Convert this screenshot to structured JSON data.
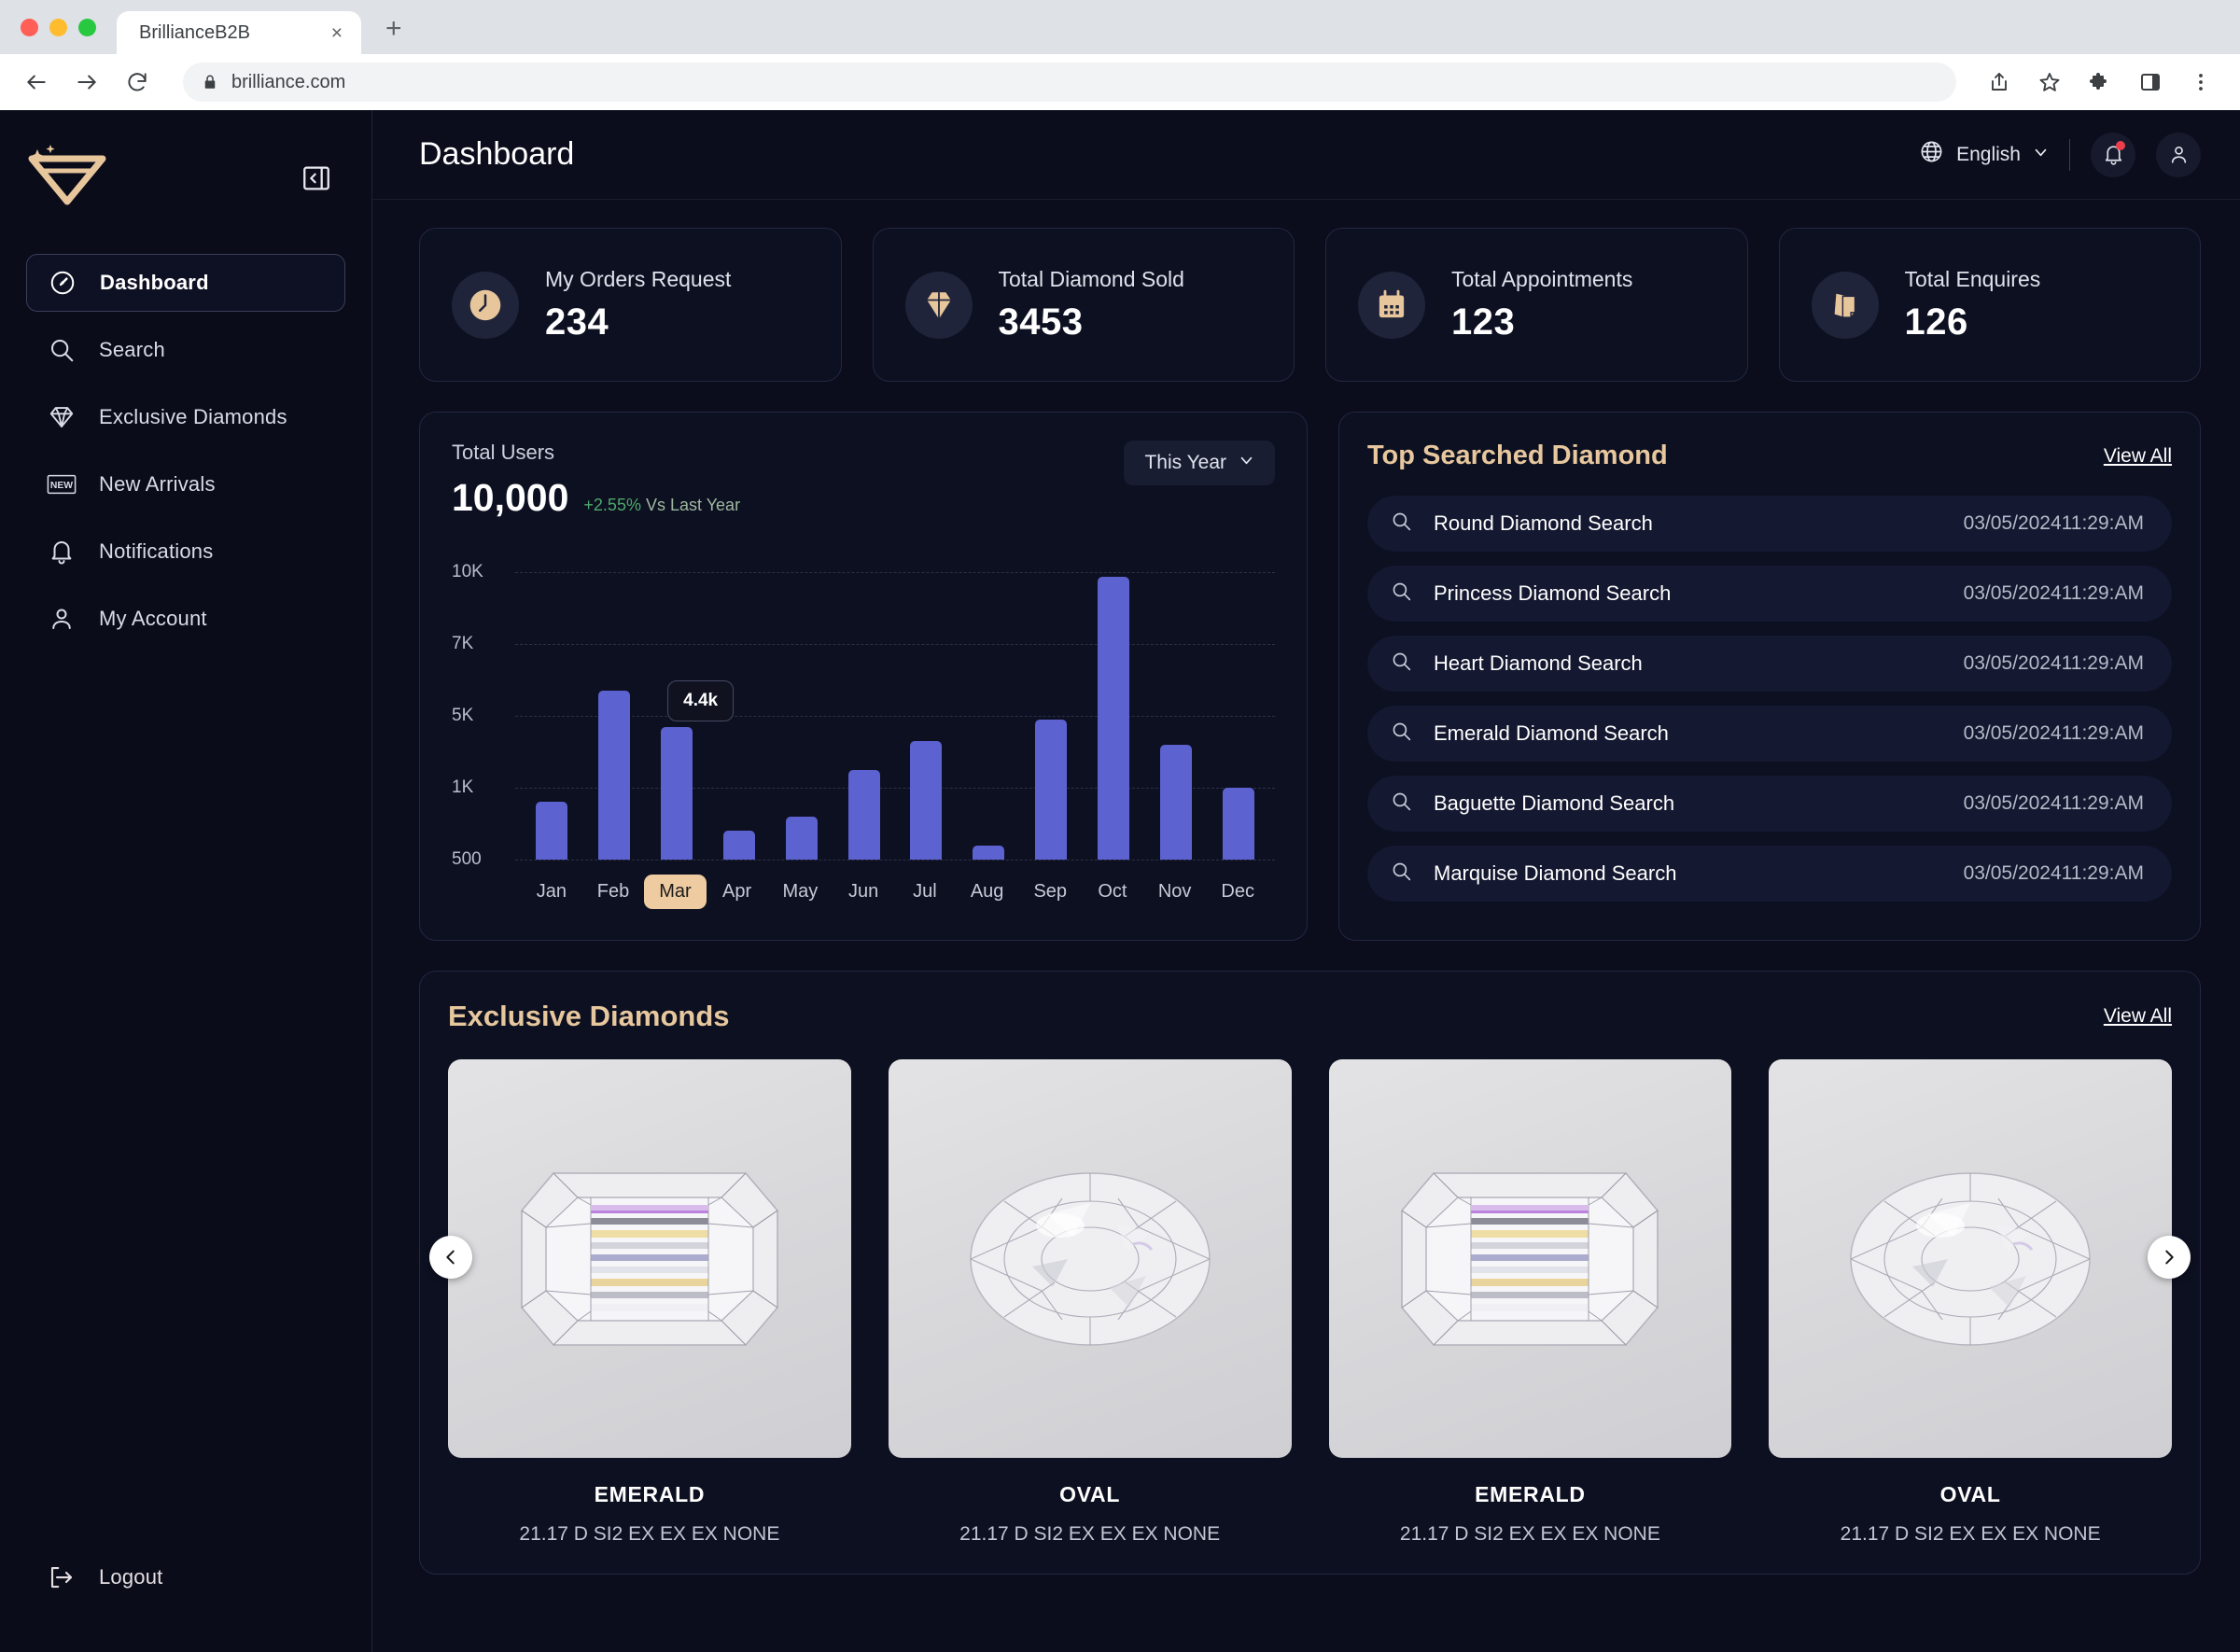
{
  "browser": {
    "tab_title": "BrillianceB2B",
    "tab_close": "×",
    "new_tab": "+",
    "url": "brilliance.com"
  },
  "sidebar": {
    "items": [
      {
        "label": "Dashboard",
        "icon": "gauge-icon",
        "active": true
      },
      {
        "label": "Search",
        "icon": "search-icon",
        "active": false
      },
      {
        "label": "Exclusive Diamonds",
        "icon": "diamond-icon",
        "active": false
      },
      {
        "label": "New Arrivals",
        "icon": "new-badge-icon",
        "active": false
      },
      {
        "label": "Notifications",
        "icon": "bell-icon",
        "active": false
      },
      {
        "label": "My Account",
        "icon": "user-icon",
        "active": false
      }
    ],
    "logout": "Logout"
  },
  "topbar": {
    "title": "Dashboard",
    "language": "English"
  },
  "stats": [
    {
      "label": "My Orders Request",
      "value": "234",
      "icon": "clock-icon"
    },
    {
      "label": "Total Diamond Sold",
      "value": "3453",
      "icon": "diamond-icon"
    },
    {
      "label": "Total Appointments",
      "value": "123",
      "icon": "calendar-icon"
    },
    {
      "label": "Total Enquires",
      "value": "126",
      "icon": "documents-icon"
    }
  ],
  "chart_panel": {
    "label": "Total Users",
    "value": "10,000",
    "delta_pct": "+2.55%",
    "delta_suffix": "Vs Last Year",
    "range": "This Year"
  },
  "chart_data": {
    "type": "bar",
    "title": "Total Users",
    "categories": [
      "Jan",
      "Feb",
      "Mar",
      "Apr",
      "May",
      "Jun",
      "Jul",
      "Aug",
      "Sep",
      "Oct",
      "Nov",
      "Dec"
    ],
    "values": [
      900,
      5700,
      4400,
      700,
      800,
      2000,
      3600,
      600,
      4800,
      9800,
      3400,
      1000
    ],
    "tooltip": {
      "category": "Mar",
      "text": "4.4k"
    },
    "selected_category": "Mar",
    "ytick_labels": [
      "500",
      "1K",
      "5K",
      "7K",
      "10K"
    ],
    "ytick_values": [
      500,
      1000,
      5000,
      7000,
      10000
    ],
    "ylim": [
      500,
      10000
    ],
    "xlabel": "",
    "ylabel": "",
    "grid": true,
    "legend": false,
    "bar_color": "#5d62d1"
  },
  "top_searched": {
    "title": "Top Searched Diamond",
    "view_all": "View All",
    "rows": [
      {
        "label": "Round Diamond Search",
        "time": "03/05/202411:29:AM"
      },
      {
        "label": "Princess Diamond Search",
        "time": "03/05/202411:29:AM"
      },
      {
        "label": "Heart Diamond Search",
        "time": "03/05/202411:29:AM"
      },
      {
        "label": "Emerald Diamond Search",
        "time": "03/05/202411:29:AM"
      },
      {
        "label": "Baguette Diamond Search",
        "time": "03/05/202411:29:AM"
      },
      {
        "label": "Marquise Diamond Search",
        "time": "03/05/202411:29:AM"
      }
    ]
  },
  "exclusive": {
    "title": "Exclusive Diamonds",
    "view_all": "View All",
    "cards": [
      {
        "name": "EMERALD",
        "spec": "21.17 D SI2 EX EX EX NONE",
        "shape": "emerald"
      },
      {
        "name": "OVAL",
        "spec": "21.17 D SI2 EX EX EX NONE",
        "shape": "oval"
      },
      {
        "name": "EMERALD",
        "spec": "21.17 D SI2 EX EX EX NONE",
        "shape": "emerald"
      },
      {
        "name": "OVAL",
        "spec": "21.17 D SI2 EX EX EX NONE",
        "shape": "oval"
      }
    ]
  },
  "colors": {
    "accent_gold": "#e7c79d",
    "bar": "#5d62d1",
    "positive": "#4ea86a",
    "notify_dot": "#ec3f4b"
  }
}
